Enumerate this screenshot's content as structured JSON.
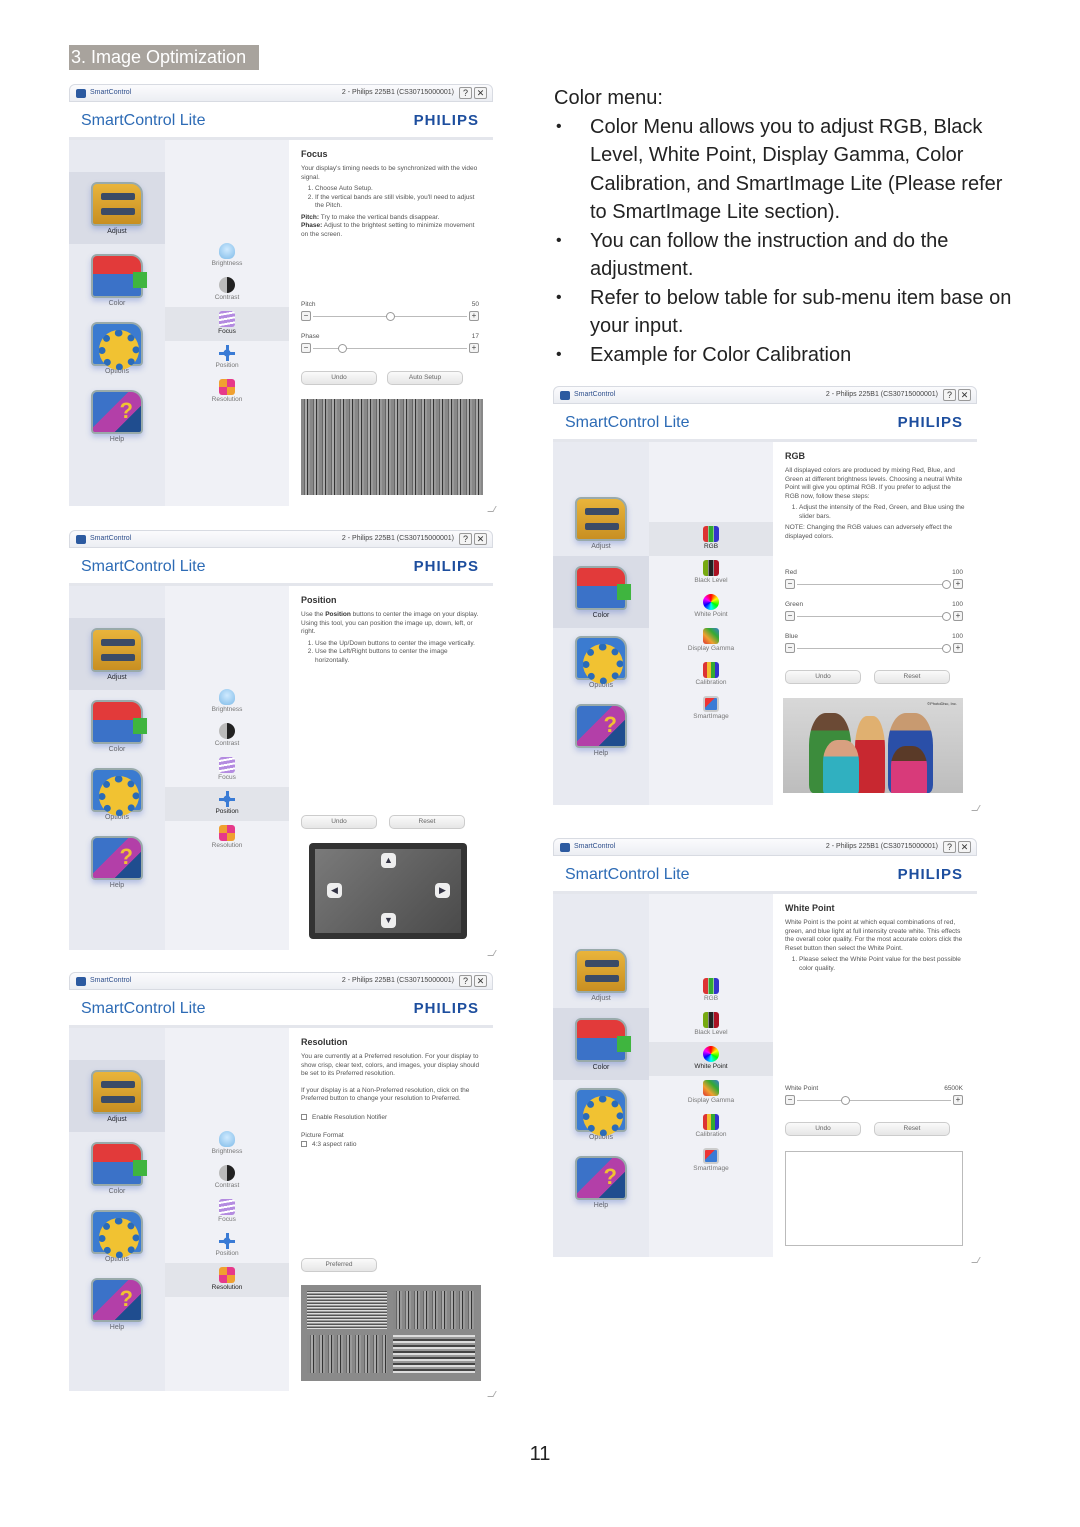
{
  "section_title": "3. Image Optimization",
  "window_common": {
    "app_name": "SmartControl",
    "title": "SmartControl Lite",
    "brand": "PHILIPS",
    "help_glyph": "?",
    "close_glyph": "✕"
  },
  "nav_main": [
    "Adjust",
    "Color",
    "Options",
    "Help"
  ],
  "nav_adjust": [
    "Brightness",
    "Contrast",
    "Focus",
    "Position",
    "Resolution"
  ],
  "nav_color": [
    "RGB",
    "Black Level",
    "White Point",
    "Display Gamma",
    "Calibration",
    "SmartImage"
  ],
  "windows": {
    "focus": {
      "device": "2 - Philips 225B1 (CS30715000001)",
      "heading": "Focus",
      "intro": "Your display's timing needs to be synchronized with the video signal.",
      "steps": [
        "Choose Auto Setup.",
        "If the vertical bands are still visible, you'll need to adjust the Pitch."
      ],
      "pitch_note": "Try to make the vertical bands disappear.",
      "phase_note": "Adjust to the brightest setting to minimize movement on the screen.",
      "pitch_label": "Pitch",
      "pitch_term": "Pitch:",
      "phase_term": "Phase:",
      "sliders": [
        {
          "label": "Pitch",
          "value": "50",
          "fraction": 0.5
        },
        {
          "label": "Phase",
          "value": "17",
          "fraction": 0.17
        }
      ],
      "buttons": [
        "Undo",
        "Auto Setup"
      ]
    },
    "position": {
      "device": "2 - Philips 225B1 (CS30715000001)",
      "heading": "Position",
      "intro_pre": "Use the ",
      "intro_bold": "Position",
      "intro_post": " buttons to center the image on your display. Using this tool, you can position the image up, down, left, or right.",
      "steps": [
        "Use the Up/Down buttons to center the image vertically.",
        "Use the Left/Right buttons to center the image horizontally."
      ],
      "buttons": [
        "Undo",
        "Reset"
      ],
      "arrows": {
        "up": "▲",
        "down": "▼",
        "left": "◀",
        "right": "▶"
      }
    },
    "resolution": {
      "device": "2 - Philips 225B1 (CS30715000001)",
      "heading": "Resolution",
      "para1": "You are currently at a Preferred resolution. For your display to show crisp, clear text, colors, and images, your display should be set to its Preferred resolution.",
      "para2": "If your display is at a Non-Preferred resolution, click on the Preferred button to change your resolution to Preferred.",
      "checkbox_notifier": "Enable Resolution Notifier",
      "picture_format_label": "Picture Format",
      "checkbox_aspect": "4:3 aspect ratio",
      "button": "Preferred"
    },
    "rgb": {
      "device": "2 - Philips 225B1 (CS30715000001)",
      "heading": "RGB",
      "para": "All displayed colors are produced by mixing Red, Blue, and Green at different brightness levels. Choosing a neutral White Point will give you optimal RGB. If you prefer to adjust the RGB now, follow these steps:",
      "steps": [
        "Adjust the intensity of the Red, Green, and Blue using the slider bars."
      ],
      "note": "NOTE: Changing the RGB values can adversely effect the displayed colors.",
      "sliders": [
        {
          "label": "Red",
          "value": "100",
          "fraction": 1.0
        },
        {
          "label": "Green",
          "value": "100",
          "fraction": 1.0
        },
        {
          "label": "Blue",
          "value": "100",
          "fraction": 1.0
        }
      ],
      "buttons": [
        "Undo",
        "Reset"
      ],
      "photo_caption": "©PhotoDisc, Inc."
    },
    "whitepoint": {
      "device": "2 - Philips 225B1 (CS30715000001)",
      "heading": "White Point",
      "para": "White Point is the point at which equal combinations of red, green, and blue light at full intensity create white. This effects the overall color quality. For the most accurate colors click the Reset button then select the White Point.",
      "steps": [
        "Please select the White Point value for the best possible color quality."
      ],
      "slider": {
        "label": "White Point",
        "value": "6500K",
        "fraction": 0.3
      },
      "buttons": [
        "Undo",
        "Reset"
      ]
    }
  },
  "color_menu": {
    "heading": "Color menu:",
    "bullets": [
      "Color Menu allows you to adjust RGB, Black Level, White Point, Display Gamma, Color Calibration, and SmartImage Lite (Please refer to SmartImage Lite section).",
      "You can follow the instruction and do the adjustment.",
      "Refer to below table for sub-menu item base on your input.",
      "Example for Color Calibration"
    ]
  },
  "page_number": "11"
}
